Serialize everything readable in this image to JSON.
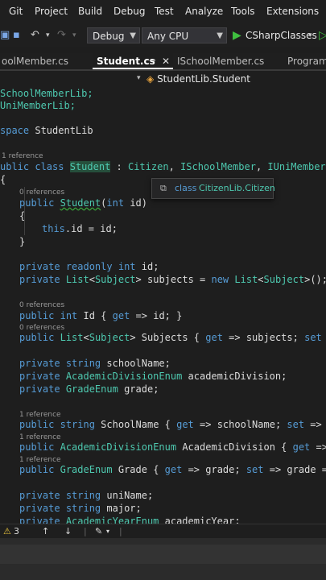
{
  "menu": {
    "items": [
      "Git",
      "Project",
      "Build",
      "Debug",
      "Test",
      "Analyze",
      "Tools",
      "Extensions"
    ]
  },
  "toolbar": {
    "config": "Debug",
    "platform": "Any CPU",
    "run_target": "CSharpClasses"
  },
  "tabs": [
    {
      "label": "oolMember.cs"
    },
    {
      "label": "Student.cs"
    },
    {
      "label": "ISchoolMember.cs"
    },
    {
      "label": "Program."
    }
  ],
  "nav": {
    "crumb": "StudentLib.Student"
  },
  "code": {
    "using1": "SchoolMemberLib;",
    "using2": "UniMemberLib;",
    "ns_kw": "space",
    "ns_name": "StudentLib",
    "ref_student": "1 reference",
    "class_pub": "ublic",
    "class_kw": "class",
    "class_name": "Student",
    "class_colon": " : ",
    "class_base1": "Citizen",
    "class_comma1": ", ",
    "class_base2": "ISchoolMember",
    "class_comma2": ", ",
    "class_base3": "IUniMember",
    "brace_open": "{",
    "ref_ctor": "0 references",
    "ctor_pub": "public",
    "ctor_name": "Student",
    "ctor_paren": "(",
    "ctor_int": "int",
    "ctor_rest": " id)",
    "ctor_open": "{",
    "ctor_this": "this",
    "ctor_body": ".id = id;",
    "ctor_close": "}",
    "f1_priv": "private",
    "f1_ro": "readonly",
    "f1_int": "int",
    "f1_rest": " id;",
    "f2_priv": "private",
    "f2_list": "List",
    "f2_lt": "<",
    "f2_subj": "Subject",
    "f2_gt": ">",
    "f2_mid": " subjects = ",
    "f2_new": "new",
    "f2_list2": "List",
    "f2_lt2": "<",
    "f2_subj2": "Subject",
    "f2_end": ">();",
    "ref_id": "0 references",
    "p1_pub": "public",
    "p1_int": "int",
    "p1_a": " Id { ",
    "p1_get": "get",
    "p1_b": " => id; }",
    "ref_subjects": "0 references",
    "p2_pub": "public",
    "p2_list": "List",
    "p2_lt": "<",
    "p2_subj": "Subject",
    "p2_gt": ">",
    "p2_a": " Subjects { ",
    "p2_get": "get",
    "p2_b": " => subjects; ",
    "p2_set": "set",
    "p2_c": " =",
    "f3_priv": "private",
    "f3_str": "string",
    "f3_rest": " schoolName;",
    "f4_priv": "private",
    "f4_type": "AcademicDivisionEnum",
    "f4_rest": " academicDivision;",
    "f5_priv": "private",
    "f5_type": "GradeEnum",
    "f5_rest": " grade;",
    "ref_schoolname": "1 reference",
    "p3_pub": "public",
    "p3_str": "string",
    "p3_a": " SchoolName { ",
    "p3_get": "get",
    "p3_b": " => schoolName; ",
    "p3_set": "set",
    "p3_c": " => s",
    "ref_division": "1 reference",
    "p4_pub": "public",
    "p4_type": "AcademicDivisionEnum",
    "p4_a": " AcademicDivision { ",
    "p4_get": "get",
    "p4_b": " =>",
    "ref_grade": "1 reference",
    "p5_pub": "public",
    "p5_type": "GradeEnum",
    "p5_a": " Grade { ",
    "p5_get": "get",
    "p5_b": " => grade; ",
    "p5_set": "set",
    "p5_c": " => grade =",
    "f6_priv": "private",
    "f6_str": "string",
    "f6_rest": " uniName;",
    "f7_priv": "private",
    "f7_str": "string",
    "f7_rest": " major;",
    "f8_priv": "private",
    "f8_type": "AcademicYearEnum",
    "f8_rest": " academicYear;"
  },
  "tooltip": {
    "kind": "class",
    "name": "CitizenLib.Citizen"
  },
  "status": {
    "warnings": "3"
  }
}
